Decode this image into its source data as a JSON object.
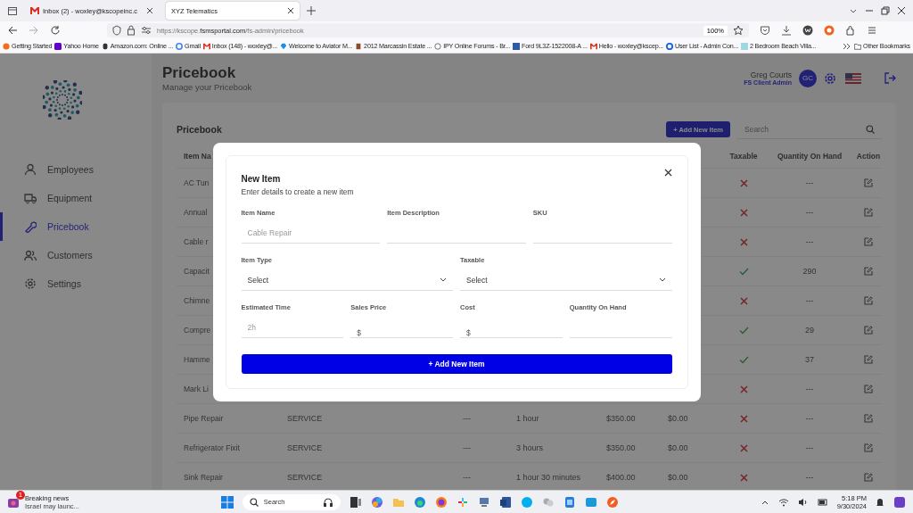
{
  "browser": {
    "tabs": [
      {
        "title": "Inbox (2) - woxley@kscopeinc.c",
        "selected": false
      },
      {
        "title": "XYZ Telematics",
        "selected": true
      }
    ],
    "url": {
      "prefix": "https://kscope.",
      "domain": "fsmsportal.com",
      "path": "/fs-admin/pricebook"
    },
    "zoom": "100%",
    "bookmarks": [
      "Getting Started",
      "Yahoo Home",
      "Amazon.com: Online ...",
      "Gmail",
      "Inbox (148) - woxley@...",
      "Welcome to Aviator M...",
      "2012 Marcassin Estate ...",
      "IPY Online Forums - Br...",
      "Ford 9L3Z-1522008-A ...",
      "Hello - woxley@kscep...",
      "User List - Admin Con...",
      "2 Bedroom Beach Villa..."
    ],
    "other_bookmarks": "Other Bookmarks"
  },
  "sidebar": {
    "items": [
      {
        "label": "Employees",
        "selected": false
      },
      {
        "label": "Equipment",
        "selected": false
      },
      {
        "label": "Pricebook",
        "selected": true
      },
      {
        "label": "Customers",
        "selected": false
      },
      {
        "label": "Settings",
        "selected": false
      }
    ]
  },
  "header": {
    "title": "Pricebook",
    "subtitle": "Manage your Pricebook",
    "user": {
      "name": "Greg Courts",
      "role": "FS Client Admin",
      "initials": "GC"
    }
  },
  "card": {
    "title": "Pricebook",
    "add_button": "+ Add New Item",
    "search": {
      "placeholder": "Search"
    }
  },
  "table": {
    "columns": [
      "Item Na",
      "",
      "",
      "",
      "",
      "",
      "Taxable",
      "Quantity On Hand",
      "Action"
    ],
    "rows": [
      {
        "name": "AC Tun",
        "taxable": false,
        "quantity": "---"
      },
      {
        "name": "Annual",
        "taxable": false,
        "quantity": "---"
      },
      {
        "name": "Cable r",
        "taxable": false,
        "quantity": "---"
      },
      {
        "name": "Capacit",
        "taxable": true,
        "quantity": "290"
      },
      {
        "name": "Chimne",
        "taxable": false,
        "quantity": "---"
      },
      {
        "name": "Compre",
        "taxable": true,
        "quantity": "29"
      },
      {
        "name": "Hamme",
        "taxable": true,
        "quantity": "37"
      },
      {
        "name": "Mark Li",
        "taxable": false,
        "quantity": "---"
      },
      {
        "name": "Pipe Repair",
        "type": "SERVICE",
        "description": "---",
        "time": "1 hour",
        "price": "$350.00",
        "cost": "$0.00",
        "taxable": false,
        "quantity": "---"
      },
      {
        "name": "Refrigerator Fixit",
        "type": "SERVICE",
        "description": "---",
        "time": "3 hours",
        "price": "$350.00",
        "cost": "$0.00",
        "taxable": false,
        "quantity": "---"
      },
      {
        "name": "Sink Repair",
        "type": "SERVICE",
        "description": "---",
        "time": "1 hour 30 minutes",
        "price": "$400.00",
        "cost": "$0.00",
        "taxable": false,
        "quantity": "---"
      }
    ]
  },
  "modal": {
    "title": "New Item",
    "subtitle": "Enter details to create a new item",
    "form_rows": [
      [
        {
          "label": "Item Name",
          "kind": "text",
          "placeholder": "Cable Repair"
        },
        {
          "label": "Item Description",
          "kind": "text"
        },
        {
          "label": "SKU",
          "kind": "text"
        }
      ],
      [
        {
          "label": "Item Type",
          "kind": "select",
          "value": "Select"
        },
        {
          "label": "Taxable",
          "kind": "select",
          "value": "Select"
        }
      ],
      [
        {
          "label": "Estimated Time",
          "kind": "text",
          "placeholder": "2h"
        },
        {
          "label": "Sales Price",
          "kind": "money",
          "prefix": "$"
        },
        {
          "label": "Cost",
          "kind": "money",
          "prefix": "$"
        },
        {
          "label": "Quantity On Hand",
          "kind": "text"
        }
      ]
    ],
    "submit": "+ Add New Item"
  },
  "taskbar": {
    "news": {
      "badge": "1",
      "title": "Breaking news",
      "text": "Israel may launc..."
    },
    "search": "Search",
    "time": "5:18 PM",
    "date": "9/30/2024"
  }
}
